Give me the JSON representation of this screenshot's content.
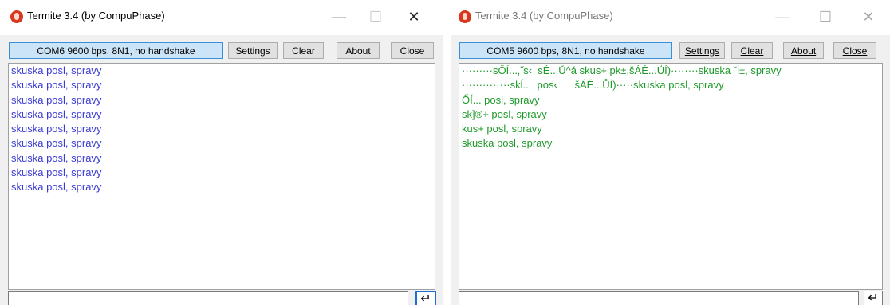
{
  "windows": [
    {
      "title": "Termite 3.4 (by CompuPhase)",
      "port_status": "COM6 9600 bps, 8N1, no handshake",
      "buttons": {
        "settings": "Settings",
        "clear": "Clear",
        "about": "About",
        "close": "Close"
      },
      "output_lines": [
        "skuska posl, spravy",
        "skuska posl, spravy",
        "skuska posl, spravy",
        "skuska posl, spravy",
        "skuska posl, spravy",
        "skuska posl, spravy",
        "skuska posl, spravy",
        "skuska posl, spravy",
        "skuska posl, spravy"
      ],
      "output_color": "#3b3bd6"
    },
    {
      "title": "Termite 3.4 (by CompuPhase)",
      "port_status": "COM5 9600 bps, 8N1, no handshake",
      "buttons": {
        "settings": "Settings",
        "clear": "Clear",
        "about": "About",
        "close": "Close"
      },
      "output_lines": [
        "·········sŐÍ...‚˝s‹  sÉ...Ů^á skus+ pk±,šÁÉ...ŮÍ)········skuska ˇĺ±, spravy",
        "··············skĺ...  pos‹      šÁÉ...ŮÍ)·····skuska posl, spravy",
        "ŐÍ... posl, spravy",
        "sk]®+ posl, spravy",
        "kus+ posl, spravy",
        "skuska posl, spravy"
      ],
      "output_color": "#1e9a2a"
    }
  ],
  "icons": {
    "app": "termite-app-icon",
    "minimize": "minimize-icon",
    "maximize": "maximize-icon",
    "close": "close-icon",
    "send": "enter-icon"
  },
  "glyphs": {
    "minimize": "—",
    "maximize": "☐",
    "close": "✕",
    "send": "↵"
  },
  "colors": {
    "port_box_bg": "#cce4f7",
    "port_box_border": "#3a8fd9",
    "app_icon": "#d8381f"
  }
}
